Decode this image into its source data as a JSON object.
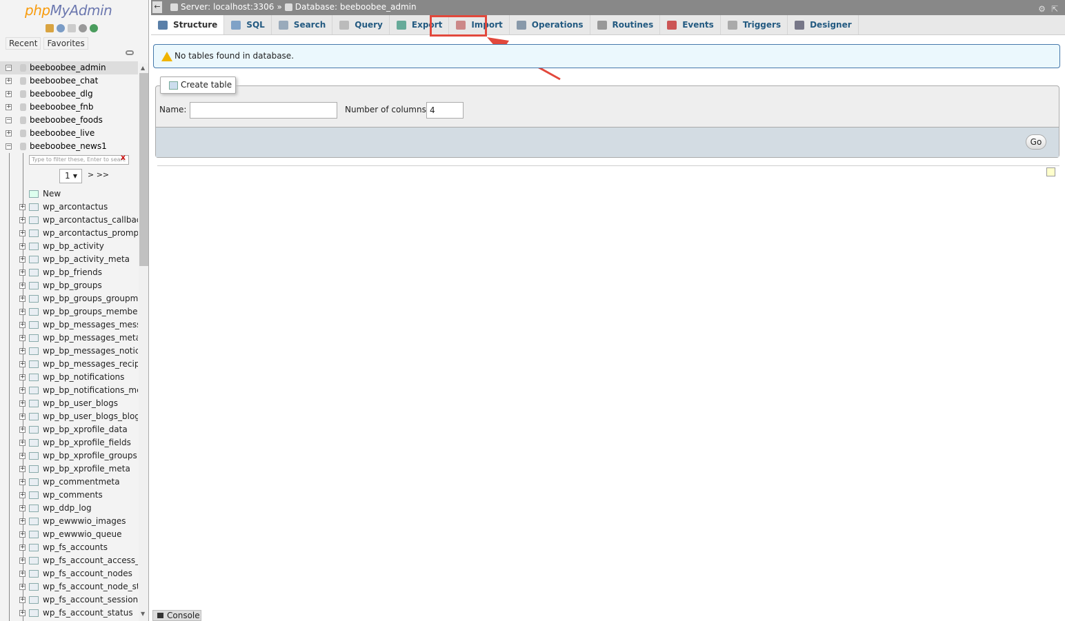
{
  "logo": {
    "php": "php",
    "myadmin": "MyAdmin"
  },
  "nav_tabs": {
    "recent": "Recent",
    "favorites": "Favorites"
  },
  "databases": [
    {
      "name": "beeboobee_admin",
      "expanded": true,
      "selected": true
    },
    {
      "name": "beeboobee_chat",
      "expanded": false
    },
    {
      "name": "beeboobee_dlg",
      "expanded": false
    },
    {
      "name": "beeboobee_fnb",
      "expanded": false
    },
    {
      "name": "beeboobee_foods",
      "expanded": true
    },
    {
      "name": "beeboobee_live",
      "expanded": false
    },
    {
      "name": "beeboobee_news1",
      "expanded": true
    }
  ],
  "filter": {
    "placeholder": "Type to filter these, Enter to searc",
    "clear": "X"
  },
  "pager": {
    "page": "1",
    "next": "> >>"
  },
  "new_label": "New",
  "tables": [
    "wp_arcontactus",
    "wp_arcontactus_callback",
    "wp_arcontactus_prompt",
    "wp_bp_activity",
    "wp_bp_activity_meta",
    "wp_bp_friends",
    "wp_bp_groups",
    "wp_bp_groups_groupme",
    "wp_bp_groups_members",
    "wp_bp_messages_mess",
    "wp_bp_messages_meta",
    "wp_bp_messages_notice",
    "wp_bp_messages_recipi",
    "wp_bp_notifications",
    "wp_bp_notifications_met",
    "wp_bp_user_blogs",
    "wp_bp_user_blogs_blog",
    "wp_bp_xprofile_data",
    "wp_bp_xprofile_fields",
    "wp_bp_xprofile_groups",
    "wp_bp_xprofile_meta",
    "wp_commentmeta",
    "wp_comments",
    "wp_ddp_log",
    "wp_ewwwio_images",
    "wp_ewwwio_queue",
    "wp_fs_accounts",
    "wp_fs_account_access_t",
    "wp_fs_account_nodes",
    "wp_fs_account_node_sta",
    "wp_fs_account_sessions",
    "wp_fs_account_status"
  ],
  "breadcrumb": {
    "server": "Server: localhost:3306",
    "sep": "»",
    "database": "Database: beeboobee_admin"
  },
  "tabs": [
    {
      "label": "Structure",
      "icon": "structure-icon",
      "color": "#5a7fa8"
    },
    {
      "label": "SQL",
      "icon": "sql-icon",
      "color": "#7fa2c7"
    },
    {
      "label": "Search",
      "icon": "search-icon",
      "color": "#9ab"
    },
    {
      "label": "Query",
      "icon": "query-icon",
      "color": "#bbb"
    },
    {
      "label": "Export",
      "icon": "export-icon",
      "color": "#6a9"
    },
    {
      "label": "Import",
      "icon": "import-icon",
      "color": "#c88"
    },
    {
      "label": "Operations",
      "icon": "wrench-icon",
      "color": "#89a"
    },
    {
      "label": "Routines",
      "icon": "routines-icon",
      "color": "#999"
    },
    {
      "label": "Events",
      "icon": "clock-icon",
      "color": "#c55"
    },
    {
      "label": "Triggers",
      "icon": "triggers-icon",
      "color": "#aaa"
    },
    {
      "label": "Designer",
      "icon": "designer-icon",
      "color": "#778"
    }
  ],
  "notice": "No tables found in database.",
  "create_table": {
    "legend": "Create table",
    "name_label": "Name:",
    "name_value": "",
    "columns_label": "Number of columns:",
    "columns_value": "4",
    "go": "Go"
  },
  "console": "Console",
  "colors": {
    "highlight": "#e2483c",
    "link": "#235a81",
    "topbar": "#888888"
  }
}
